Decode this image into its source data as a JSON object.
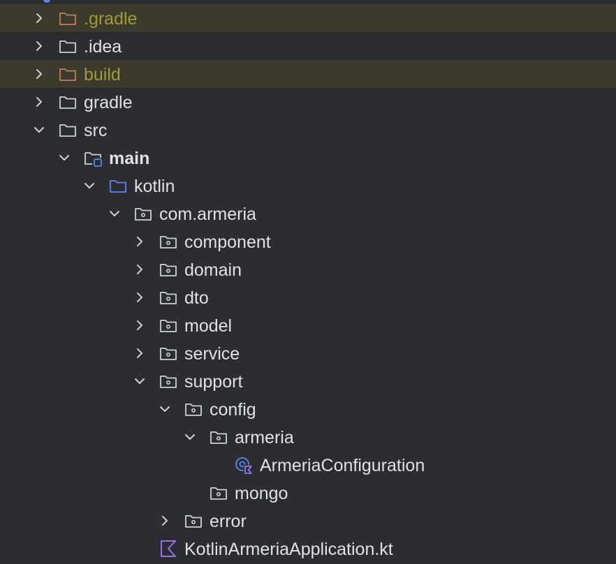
{
  "project_tree": {
    "items": [
      {
        "label": ".gradle",
        "depth": 0,
        "expanded": false,
        "icon": "folder-excluded-icon",
        "excluded": true,
        "bold": false
      },
      {
        "label": ".idea",
        "depth": 0,
        "expanded": false,
        "icon": "folder-icon",
        "excluded": false,
        "bold": false
      },
      {
        "label": "build",
        "depth": 0,
        "expanded": false,
        "icon": "folder-excluded-icon",
        "excluded": true,
        "bold": false
      },
      {
        "label": "gradle",
        "depth": 0,
        "expanded": false,
        "icon": "folder-icon",
        "excluded": false,
        "bold": false
      },
      {
        "label": "src",
        "depth": 0,
        "expanded": true,
        "icon": "folder-icon",
        "excluded": false,
        "bold": false
      },
      {
        "label": "main",
        "depth": 1,
        "expanded": true,
        "icon": "module-folder-icon",
        "excluded": false,
        "bold": true
      },
      {
        "label": "kotlin",
        "depth": 2,
        "expanded": true,
        "icon": "source-root-folder-icon",
        "excluded": false,
        "bold": false
      },
      {
        "label": "com.armeria",
        "depth": 3,
        "expanded": true,
        "icon": "package-icon",
        "excluded": false,
        "bold": false
      },
      {
        "label": "component",
        "depth": 4,
        "expanded": false,
        "icon": "package-icon",
        "excluded": false,
        "bold": false
      },
      {
        "label": "domain",
        "depth": 4,
        "expanded": false,
        "icon": "package-icon",
        "excluded": false,
        "bold": false
      },
      {
        "label": "dto",
        "depth": 4,
        "expanded": false,
        "icon": "package-icon",
        "excluded": false,
        "bold": false
      },
      {
        "label": "model",
        "depth": 4,
        "expanded": false,
        "icon": "package-icon",
        "excluded": false,
        "bold": false
      },
      {
        "label": "service",
        "depth": 4,
        "expanded": false,
        "icon": "package-icon",
        "excluded": false,
        "bold": false
      },
      {
        "label": "support",
        "depth": 4,
        "expanded": true,
        "icon": "package-icon",
        "excluded": false,
        "bold": false
      },
      {
        "label": "config",
        "depth": 5,
        "expanded": true,
        "icon": "package-icon",
        "excluded": false,
        "bold": false
      },
      {
        "label": "armeria",
        "depth": 6,
        "expanded": true,
        "icon": "package-icon",
        "excluded": false,
        "bold": false
      },
      {
        "label": "ArmeriaConfiguration",
        "depth": 7,
        "expanded": null,
        "icon": "kotlin-spring-config-class-icon",
        "excluded": false,
        "bold": false
      },
      {
        "label": "mongo",
        "depth": 6,
        "expanded": null,
        "icon": "package-icon",
        "excluded": false,
        "bold": false
      },
      {
        "label": "error",
        "depth": 5,
        "expanded": false,
        "icon": "package-icon",
        "excluded": false,
        "bold": false
      },
      {
        "label": "KotlinArmeriaApplication.kt",
        "depth": 4,
        "expanded": null,
        "icon": "kotlin-file-icon",
        "excluded": false,
        "bold": false
      }
    ]
  },
  "colors": {
    "background": "#2b2d30",
    "excluded_row": "#3b3a2c",
    "excluded_text": "#a39a39",
    "excluded_folder": "#c77d55",
    "text": "#dfe1e5",
    "icon_stroke": "#ced0d6",
    "source_root": "#548af7",
    "kotlin": "#9e6ef3"
  }
}
